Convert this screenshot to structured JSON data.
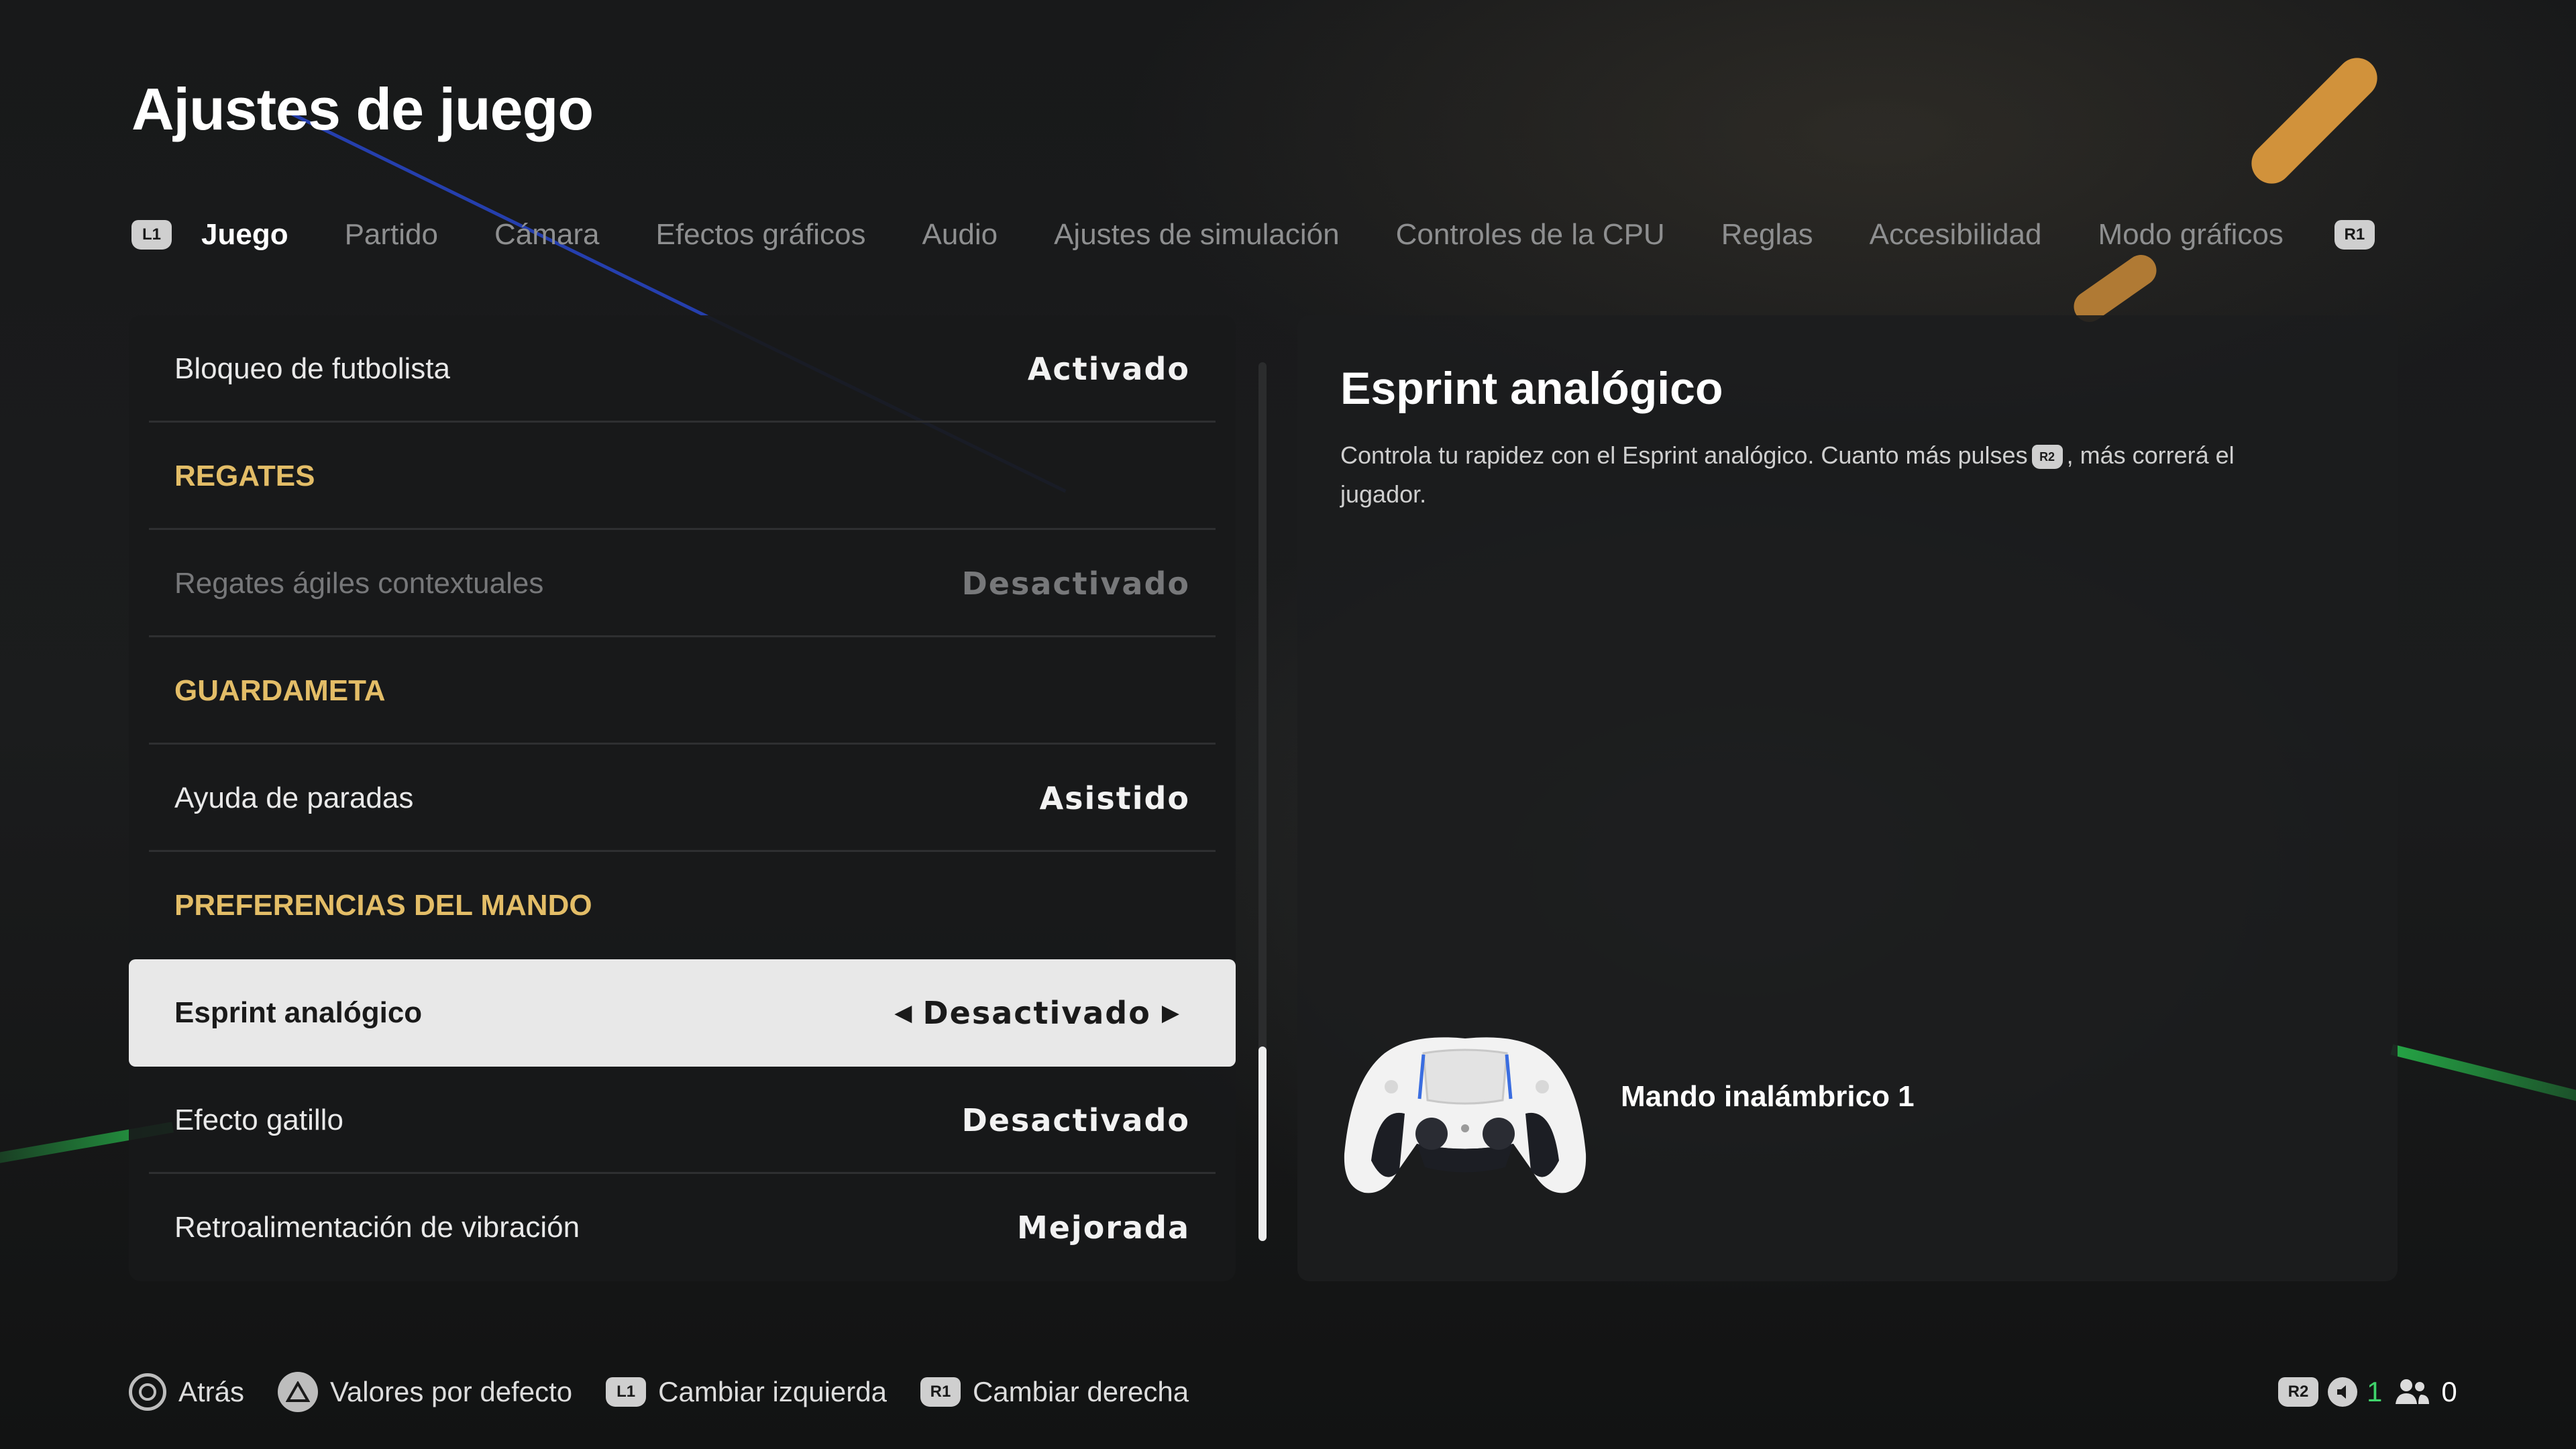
{
  "title": "Ajustes de juego",
  "tabs": {
    "left_button": "L1",
    "right_button": "R1",
    "items": [
      {
        "label": "Juego",
        "active": true
      },
      {
        "label": "Partido"
      },
      {
        "label": "Cámara"
      },
      {
        "label": "Efectos gráficos"
      },
      {
        "label": "Audio"
      },
      {
        "label": "Ajustes de simulación"
      },
      {
        "label": "Controles de la CPU"
      },
      {
        "label": "Reglas"
      },
      {
        "label": "Accesibilidad"
      },
      {
        "label": "Modo gráficos"
      }
    ]
  },
  "settings": [
    {
      "label": "Bloqueo de futbolista",
      "value": "Activado"
    },
    {
      "label": "REGATES",
      "section": true
    },
    {
      "label": "Regates ágiles contextuales",
      "value": "Desactivado",
      "disabled": true
    },
    {
      "label": "GUARDAMETA",
      "section": true
    },
    {
      "label": "Ayuda de paradas",
      "value": "Asistido"
    },
    {
      "label": "PREFERENCIAS DEL MANDO",
      "section": true
    },
    {
      "label": "Esprint analógico",
      "value": "Desactivado",
      "selected": true
    },
    {
      "label": "Efecto gatillo",
      "value": "Desactivado"
    },
    {
      "label": "Retroalimentación de vibración",
      "value": "Mejorada"
    }
  ],
  "detail": {
    "title": "Esprint analógico",
    "desc_before": "Controla tu rapidez con el Esprint analógico. Cuanto más pulses",
    "desc_button": "R2",
    "desc_after": ", más correrá el jugador.",
    "controller_label": "Mando inalámbrico 1"
  },
  "footer": {
    "back": "Atrás",
    "defaults": "Valores por defecto",
    "switch_left_button": "L1",
    "switch_left": "Cambiar izquierda",
    "switch_right_button": "R1",
    "switch_right": "Cambiar derecha"
  },
  "status": {
    "button": "R2",
    "voice_count": "1",
    "party_count": "0"
  },
  "icons": [
    "circle-button-icon",
    "triangle-button-icon",
    "speaker-icon",
    "party-icon",
    "controller-icon",
    "arrow-left-icon",
    "arrow-right-icon"
  ],
  "colors": {
    "section": "#e3bd67",
    "selected_bg": "#e8e8e8",
    "status_green": "#3fd36b"
  }
}
